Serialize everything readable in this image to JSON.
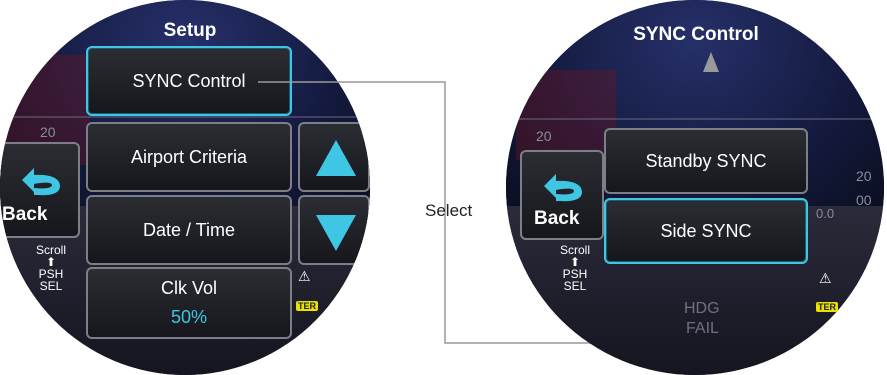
{
  "left": {
    "title": "Setup",
    "menu": [
      {
        "label": "SYNC Control",
        "selected": true
      },
      {
        "label": "Airport Criteria",
        "selected": false
      },
      {
        "label": "Date / Time",
        "selected": false
      }
    ],
    "clk_vol": {
      "label": "Clk Vol",
      "value": "50%"
    },
    "back_label": "Back",
    "scroll_hint": {
      "line1": "Scroll",
      "line2": "PSH",
      "line3": "SEL"
    },
    "icons": {
      "up": "scroll-up-arrow-icon",
      "down": "scroll-down-arrow-icon",
      "back": "back-arrow-icon"
    },
    "bg_text": {
      "pitch": "20",
      "ter": "TER"
    }
  },
  "callout": {
    "label": "Select"
  },
  "right": {
    "title": "SYNC Control",
    "menu": [
      {
        "label": "Standby SYNC",
        "selected": false
      },
      {
        "label": "Side SYNC",
        "selected": true
      }
    ],
    "back_label": "Back",
    "scroll_hint": {
      "line1": "Scroll",
      "line2": "PSH",
      "line3": "SEL"
    },
    "bg_text": {
      "pitch": "20",
      "alt_20": "20",
      "alt_00": "00",
      "alt_0": "0.0",
      "hdg1": "HDG",
      "hdg2": "FAIL",
      "ter": "TER"
    }
  },
  "colors": {
    "accent": "#3ec6e4",
    "button_border": "#7c7f87",
    "ter_badge": "#e9e200"
  }
}
